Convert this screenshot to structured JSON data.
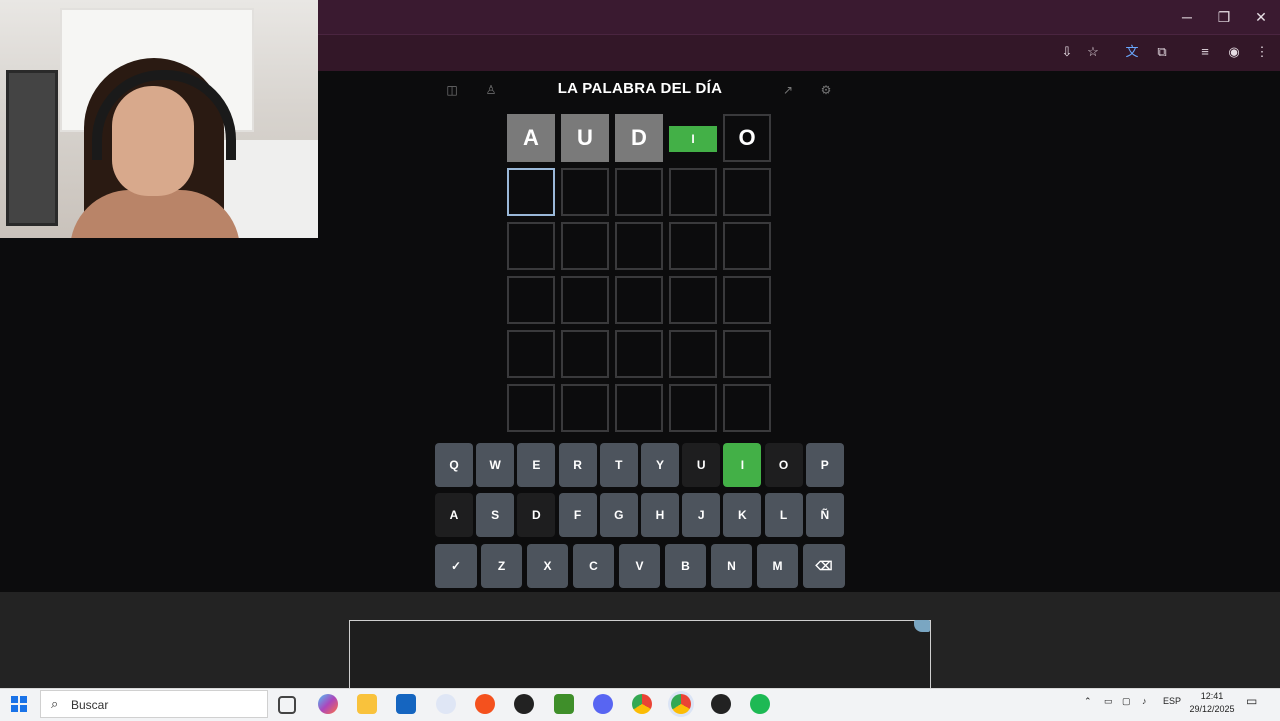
{
  "browser": {
    "toolbar_icons": [
      "install-icon",
      "star-icon",
      "translate-icon",
      "extensions-icon",
      "media-icon",
      "profile-icon",
      "menu-icon"
    ]
  },
  "game": {
    "title": "LA PALABRA DEL DÍA",
    "rows": [
      [
        {
          "letter": "A",
          "state": "gray"
        },
        {
          "letter": "U",
          "state": "gray"
        },
        {
          "letter": "D",
          "state": "gray"
        },
        {
          "letter": "I",
          "state": "green"
        },
        {
          "letter": "O",
          "state": "outlined"
        }
      ],
      [
        {
          "letter": "",
          "state": "active"
        },
        {
          "letter": "",
          "state": "empty"
        },
        {
          "letter": "",
          "state": "empty"
        },
        {
          "letter": "",
          "state": "empty"
        },
        {
          "letter": "",
          "state": "empty"
        }
      ],
      [
        {
          "letter": "",
          "state": "empty"
        },
        {
          "letter": "",
          "state": "empty"
        },
        {
          "letter": "",
          "state": "empty"
        },
        {
          "letter": "",
          "state": "empty"
        },
        {
          "letter": "",
          "state": "empty"
        }
      ],
      [
        {
          "letter": "",
          "state": "empty"
        },
        {
          "letter": "",
          "state": "empty"
        },
        {
          "letter": "",
          "state": "empty"
        },
        {
          "letter": "",
          "state": "empty"
        },
        {
          "letter": "",
          "state": "empty"
        }
      ],
      [
        {
          "letter": "",
          "state": "empty"
        },
        {
          "letter": "",
          "state": "empty"
        },
        {
          "letter": "",
          "state": "empty"
        },
        {
          "letter": "",
          "state": "empty"
        },
        {
          "letter": "",
          "state": "empty"
        }
      ],
      [
        {
          "letter": "",
          "state": "empty"
        },
        {
          "letter": "",
          "state": "empty"
        },
        {
          "letter": "",
          "state": "empty"
        },
        {
          "letter": "",
          "state": "empty"
        },
        {
          "letter": "",
          "state": "empty"
        }
      ]
    ],
    "keyboard": {
      "row1": [
        {
          "label": "Q",
          "state": "default"
        },
        {
          "label": "W",
          "state": "default"
        },
        {
          "label": "E",
          "state": "default"
        },
        {
          "label": "R",
          "state": "default"
        },
        {
          "label": "T",
          "state": "default"
        },
        {
          "label": "Y",
          "state": "default"
        },
        {
          "label": "U",
          "state": "used"
        },
        {
          "label": "I",
          "state": "green"
        },
        {
          "label": "O",
          "state": "used"
        },
        {
          "label": "P",
          "state": "default"
        }
      ],
      "row2": [
        {
          "label": "A",
          "state": "used"
        },
        {
          "label": "S",
          "state": "default"
        },
        {
          "label": "D",
          "state": "used"
        },
        {
          "label": "F",
          "state": "default"
        },
        {
          "label": "G",
          "state": "default"
        },
        {
          "label": "H",
          "state": "default"
        },
        {
          "label": "J",
          "state": "default"
        },
        {
          "label": "K",
          "state": "default"
        },
        {
          "label": "L",
          "state": "default"
        },
        {
          "label": "Ñ",
          "state": "default"
        }
      ],
      "row3": [
        {
          "label": "✓",
          "state": "default",
          "name": "enter-key"
        },
        {
          "label": "Z",
          "state": "default"
        },
        {
          "label": "X",
          "state": "default"
        },
        {
          "label": "C",
          "state": "default"
        },
        {
          "label": "V",
          "state": "default"
        },
        {
          "label": "B",
          "state": "default"
        },
        {
          "label": "N",
          "state": "default"
        },
        {
          "label": "M",
          "state": "default"
        },
        {
          "label": "⌫",
          "state": "default",
          "name": "backspace-key"
        }
      ]
    },
    "colors": {
      "green": "#43b047",
      "gray": "#7a7a7a",
      "key": "#4d545d",
      "used": "#1e1e1f"
    }
  },
  "taskbar": {
    "search_label": "Buscar",
    "language": "ESP",
    "time": "12:41",
    "date": "29/12/2025"
  }
}
